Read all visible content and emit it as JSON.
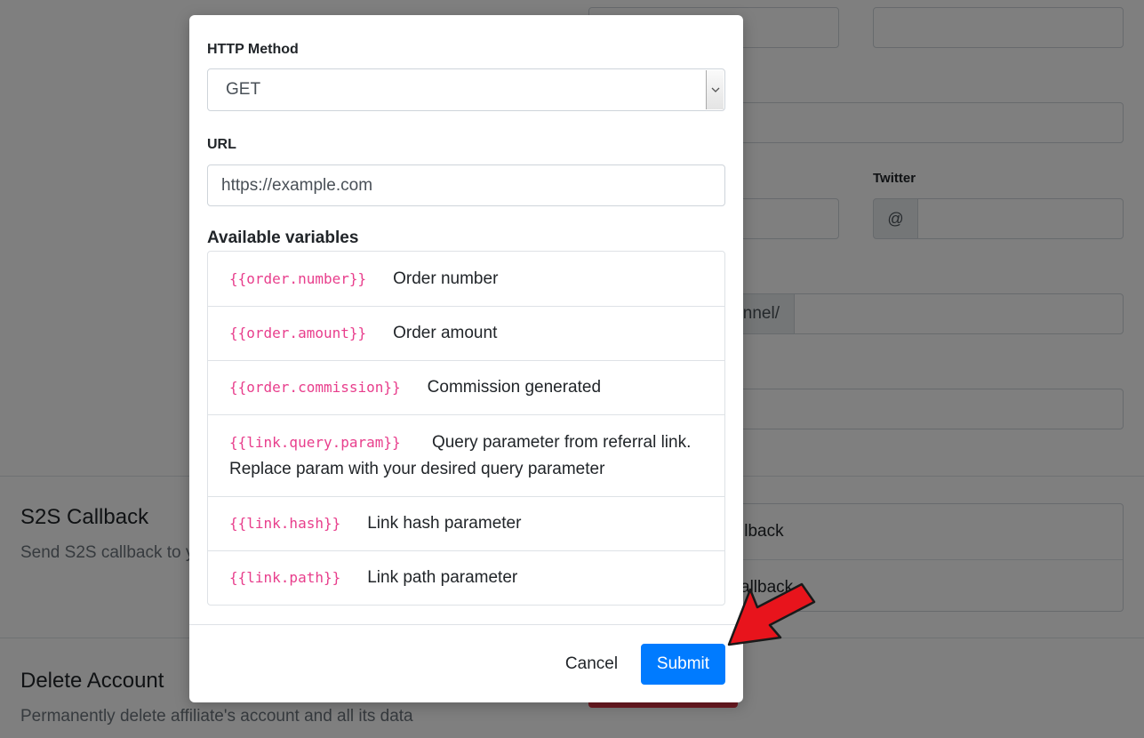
{
  "background": {
    "twitter_label": "Twitter",
    "twitter_addon": "@",
    "channel_addon_text": "nnel/",
    "s2s_title": "S2S Callback",
    "s2s_subtitle": "Send S2S callback to y",
    "s2s_options": [
      "llback",
      "allback"
    ],
    "delete_title": "Delete Account",
    "delete_subtitle": "Permanently delete affiliate's account and all its data"
  },
  "modal": {
    "method_label": "HTTP Method",
    "method_value": "GET",
    "url_label": "URL",
    "url_placeholder": "https://example.com",
    "variables_title": "Available variables",
    "variables": [
      {
        "code": "{{order.number}}",
        "desc": "Order number"
      },
      {
        "code": "{{order.amount}}",
        "desc": "Order amount"
      },
      {
        "code": "{{order.commission}}",
        "desc": "Commission generated"
      },
      {
        "code": "{{link.query.param}}",
        "desc": "Query parameter from referral link.",
        "desc2": "Replace param with your desired query parameter"
      },
      {
        "code": "{{link.hash}}",
        "desc": "Link hash parameter"
      },
      {
        "code": "{{link.path}}",
        "desc": "Link path parameter"
      }
    ],
    "cancel_label": "Cancel",
    "submit_label": "Submit"
  },
  "colors": {
    "primary": "#007bff",
    "code": "#e83e8c",
    "danger": "#dc3545",
    "annotation_arrow": "#e8141c"
  },
  "icons": {
    "select_arrow": "chevron-down-icon",
    "annotation": "red-arrow-icon"
  }
}
